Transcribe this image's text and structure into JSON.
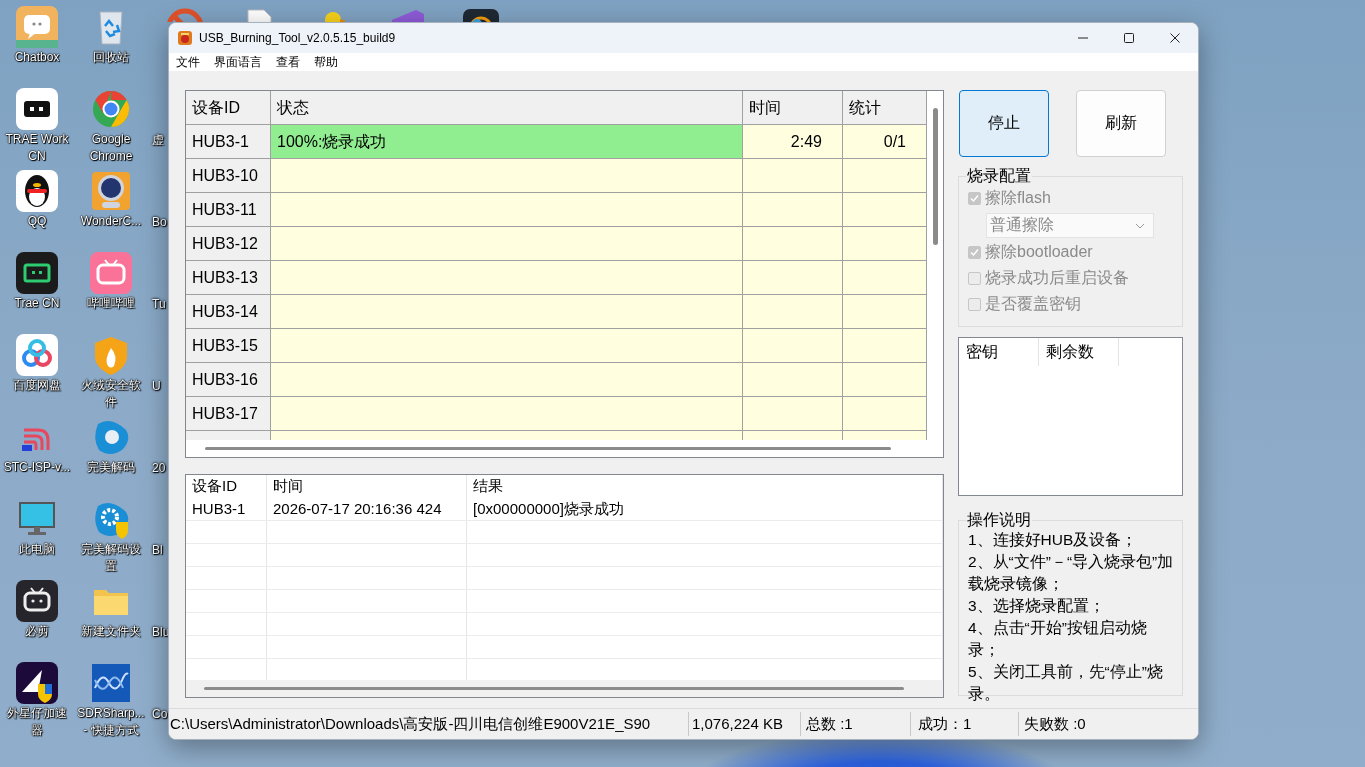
{
  "desktop": {
    "icons": [
      {
        "label": "Chatbox"
      },
      {
        "label": "TRAE Work CN"
      },
      {
        "label": "QQ"
      },
      {
        "label": "Trae CN"
      },
      {
        "label": "百度网盘"
      },
      {
        "label": "STC-ISP-v..."
      },
      {
        "label": "此电脑"
      },
      {
        "label": "必剪"
      },
      {
        "label": "外星仔加速器"
      },
      {
        "label": "回收站"
      },
      {
        "label": "Google Chrome"
      },
      {
        "label": "WonderC..."
      },
      {
        "label": "哔哩哔哩"
      },
      {
        "label": "火绒安全软件"
      },
      {
        "label": "完美解码"
      },
      {
        "label": "完美解码设置"
      },
      {
        "label": "新建文件夹"
      },
      {
        "label": "SDRSharp... - 快捷方式"
      }
    ],
    "cut_off_labels": [
      "虚",
      "Bo",
      "Tu",
      "U",
      "20",
      "Bl",
      "Blu",
      "Co"
    ]
  },
  "window": {
    "title": "USB_Burning_Tool_v2.0.5.15_build9",
    "menu": [
      "文件",
      "界面语言",
      "查看",
      "帮助"
    ],
    "device_table": {
      "columns": [
        "设备ID",
        "状态",
        "时间",
        "统计"
      ],
      "rows": [
        {
          "id": "HUB3-1",
          "status": "100%:烧录成功",
          "time": "2:49",
          "count": "0/1",
          "success": true
        },
        {
          "id": "HUB3-10",
          "success": false
        },
        {
          "id": "HUB3-11",
          "success": false
        },
        {
          "id": "HUB3-12",
          "success": false
        },
        {
          "id": "HUB3-13",
          "success": false
        },
        {
          "id": "HUB3-14",
          "success": false
        },
        {
          "id": "HUB3-15",
          "success": false
        },
        {
          "id": "HUB3-16",
          "success": false
        },
        {
          "id": "HUB3-17",
          "success": false
        }
      ]
    },
    "log": {
      "columns": [
        "设备ID",
        "时间",
        "结果"
      ],
      "rows": [
        {
          "device": "HUB3-1",
          "time": "2026-07-17 20:16:36 424",
          "result": "[0x00000000]烧录成功"
        }
      ]
    },
    "buttons": [
      {
        "label": "停止",
        "focused": true
      },
      {
        "label": "刷新",
        "focused": false
      }
    ],
    "burn_config": {
      "title": "烧录配置",
      "options": [
        {
          "kind": "checkbox",
          "label": "擦除flash",
          "checked": true,
          "disabled": true
        },
        {
          "kind": "dropdown",
          "value": "普通擦除",
          "disabled": true
        },
        {
          "kind": "checkbox",
          "label": "擦除bootloader",
          "checked": true,
          "disabled": true
        },
        {
          "kind": "checkbox",
          "label": "烧录成功后重启设备",
          "checked": false,
          "disabled": true
        },
        {
          "kind": "checkbox",
          "label": "是否覆盖密钥",
          "checked": false,
          "disabled": true
        }
      ]
    },
    "key_table": {
      "columns": [
        "密钥",
        "剩余数"
      ]
    },
    "instructions": {
      "title": "操作说明",
      "steps": [
        "1、连接好HUB及设备；",
        "2、从“文件”－“导入烧录包”加载烧录镜像；",
        "3、选择烧录配置；",
        "4、点击“开始”按钮启动烧录；",
        "5、关闭工具前，先“停止”烧录。"
      ]
    },
    "status_bar": [
      "C:\\Users\\Administrator\\Downloads\\高安版-四川电信创维E900V21E_S90",
      "1,076,224 KB",
      "总数 :1",
      "成功：1",
      "失败数 :0"
    ]
  }
}
